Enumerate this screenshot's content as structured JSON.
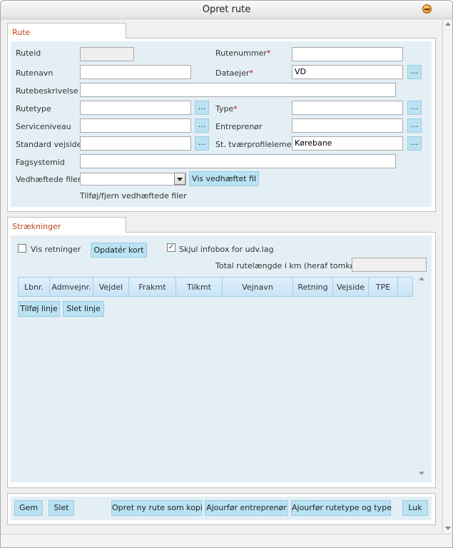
{
  "window": {
    "title": "Opret rute"
  },
  "rute_tab": "Rute",
  "form": {
    "ruteid_label": "Ruteid",
    "rutenummer_label": "Rutenummer",
    "rutenavn_label": "Rutenavn",
    "dataejer_label": "Dataejer",
    "dataejer_value": "VD",
    "rutebeskrivelse_label": "Rutebeskrivelse",
    "rutetype_label": "Rutetype",
    "type_label": "Type",
    "serviceniveau_label": "Serviceniveau",
    "entreprenor_label": "Entreprenør",
    "standard_vejside_label": "Standard vejside",
    "st_tvaerprofil_label": "St. tværprofilelement",
    "st_tvaerprofil_value": "Kørebane",
    "fagsystemid_label": "Fagsystemid",
    "vedhaeftede_label": "Vedhæftede filer:",
    "vis_vedhaeftet_button": "Vis vedhæftet fil",
    "tilfoj_fjern_text": "Tilføj/fjern vedhæftede filer",
    "required_mark": "*",
    "dots_label": "..."
  },
  "straekninger": {
    "tab": "Strækninger",
    "vis_retninger_label": "Vis retninger",
    "opdater_kort_button": "Opdatér kort",
    "skjul_infobox_label": "Skjul infobox for udv.lag",
    "skjul_infobox_checked": "✓",
    "total_label": "Total rutelængde i km (heraf tomkørsel)",
    "columns": [
      "Lbnr.",
      "Admvejnr.",
      "Vejdel",
      "Frakmt",
      "Tilkmt",
      "Vejnavn",
      "Retning",
      "Vejside",
      "TPE"
    ],
    "tilfoj_linje_button": "Tilføj linje",
    "slet_linje_button": "Slet linje"
  },
  "footer": {
    "gem": "Gem",
    "slet": "Slet",
    "opret_kopi": "Opret ny rute som kopi",
    "ajourfor_entreprenor": "Ajourfør entreprenør",
    "ajourfor_rutetype": "Ajourfør rutetype og type",
    "luk": "Luk"
  }
}
